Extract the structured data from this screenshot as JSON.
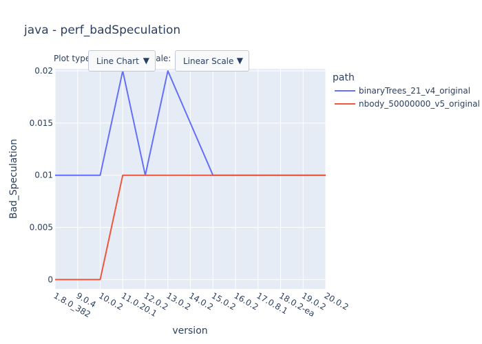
{
  "title": "java - perf_badSpeculation",
  "controls": {
    "plot_type_label": "Plot type:",
    "plot_type_value": "Line Chart",
    "scale_label": "Scale:",
    "scale_value": "Linear Scale"
  },
  "legend": {
    "title": "path"
  },
  "colors": {
    "series1": "#636efa",
    "series2": "#ef553b",
    "plot_bg": "#e5ecf6",
    "grid": "#ffffff"
  },
  "chart_data": {
    "type": "line",
    "title": "java - perf_badSpeculation",
    "xlabel": "version",
    "ylabel": "Bad_Speculation",
    "categories": [
      "1.8.0_382",
      "9.0.4",
      "10.0.2",
      "11.0.20.1",
      "12.0.2",
      "13.0.2",
      "14.0.2",
      "15.0.2",
      "16.0.2",
      "17.0.8.1",
      "18.0.2-ea",
      "19.0.2",
      "20.0.2"
    ],
    "x_tick_labels": [
      "1.8.0_382",
      "9.0.4",
      "10.0.2",
      "11.0.20.1",
      "12.0.2",
      "13.0.2",
      "14.0.2",
      "15.0.2",
      "16.0.2",
      "17.0.8.1",
      "18.0.2-ea",
      "19.0.2",
      "20.0.2"
    ],
    "y_ticks": [
      0,
      0.005,
      0.01,
      0.015,
      0.02
    ],
    "y_tick_labels": [
      "0",
      "0.005",
      "0.01",
      "0.015",
      "0.02"
    ],
    "ylim": [
      -0.0009,
      0.0202
    ],
    "grid": true,
    "legend_position": "right",
    "series": [
      {
        "name": "binaryTrees_21_v4_original",
        "color": "#636efa",
        "values": [
          0.01,
          0.01,
          0.01,
          0.02,
          0.01,
          0.02,
          0.015,
          0.01,
          0.01,
          0.01,
          0.01,
          0.01,
          0.01
        ]
      },
      {
        "name": "nbody_50000000_v5_original",
        "color": "#ef553b",
        "values": [
          0,
          0,
          0,
          0.01,
          0.01,
          0.01,
          0.01,
          0.01,
          0.01,
          0.01,
          0.01,
          0.01,
          0.01
        ]
      }
    ]
  }
}
